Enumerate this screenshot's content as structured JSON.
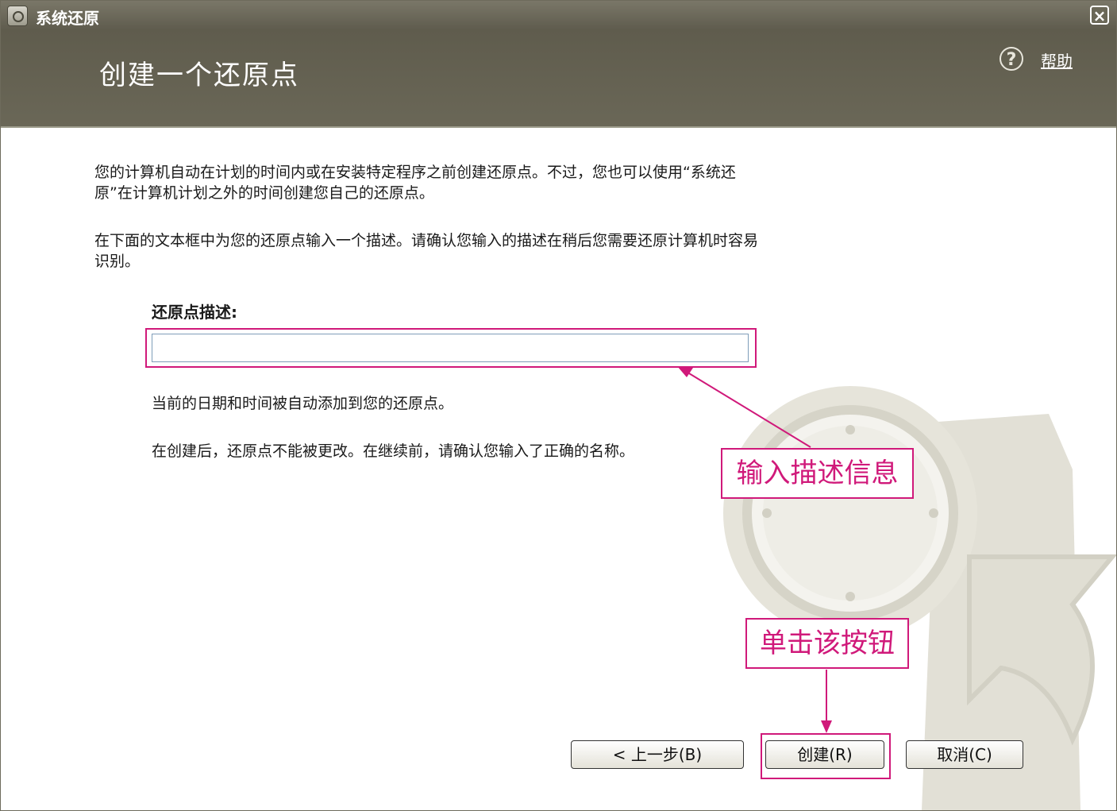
{
  "window": {
    "title": "系统还原",
    "close_label": "×"
  },
  "header": {
    "title": "创建一个还原点",
    "help_label": "帮助",
    "help_icon": "question-icon"
  },
  "body": {
    "paragraph1_line1": "您的计算机自动在计划的时间内或在安装特定程序之前创建还原点。不过，您也可以使用“系统还",
    "paragraph1_line2": "原”在计算机计划之外的时间创建您自己的还原点。",
    "paragraph2_line1": "在下面的文本框中为您的还原点输入一个描述。请确认您输入的描述在稍后您需要还原计算机时容易",
    "paragraph2_line2": "识别。",
    "input_label": "还原点描述:",
    "input_value": "",
    "note1": "当前的日期和时间被自动添加到您的还原点。",
    "note2": "在创建后，还原点不能被更改。在继续前，请确认您输入了正确的名称。"
  },
  "annotations": {
    "input_callout": "输入描述信息",
    "button_callout": "单击该按钮",
    "highlight_color": "#d0197a"
  },
  "buttons": {
    "back": "< 上一步(B)",
    "create": "创建(R)",
    "cancel": "取消(C)"
  }
}
